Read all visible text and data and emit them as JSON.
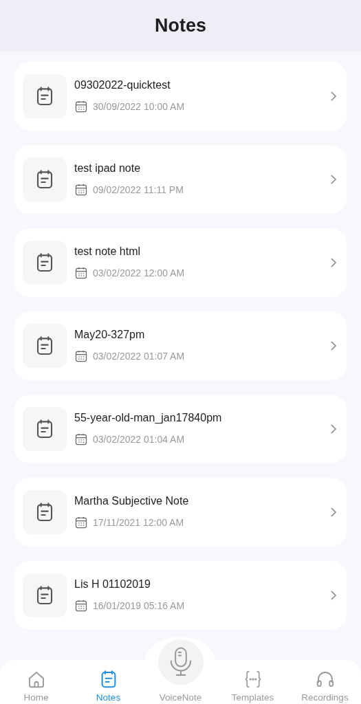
{
  "header": {
    "title": "Notes"
  },
  "notes": [
    {
      "title": "09302022-quicktest",
      "date": "30/09/2022 10:00 AM"
    },
    {
      "title": "test ipad note",
      "date": "09/02/2022 11:11 PM"
    },
    {
      "title": "test note html",
      "date": "03/02/2022 12:00 AM"
    },
    {
      "title": "May20-327pm",
      "date": "03/02/2022 01:07 AM"
    },
    {
      "title": "55-year-old-man_jan17840pm",
      "date": "03/02/2022 01:04 AM"
    },
    {
      "title": "Martha Subjective Note",
      "date": "17/11/2021 12:00 AM"
    },
    {
      "title": "Lis H 01102019",
      "date": "16/01/2019 05:16 AM"
    }
  ],
  "tabs": [
    {
      "kind": "home",
      "label": "Home",
      "selected": false
    },
    {
      "kind": "notes",
      "label": "Notes",
      "selected": true
    },
    {
      "kind": "mic",
      "label": "VoiceNote",
      "selected": false
    },
    {
      "kind": "templates",
      "label": "Templates",
      "selected": false
    },
    {
      "kind": "headphones",
      "label": "Recordings",
      "selected": false
    }
  ]
}
